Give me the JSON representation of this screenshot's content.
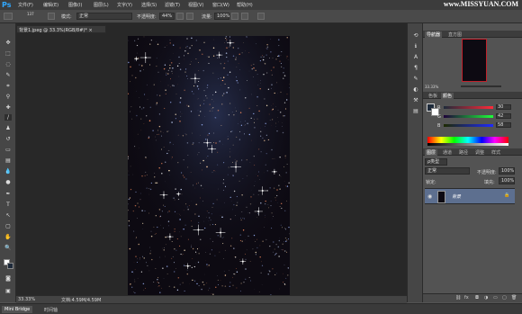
{
  "app": {
    "logo": "Ps"
  },
  "menubar": {
    "items": [
      "文件(F)",
      "编辑(E)",
      "图像(I)",
      "图层(L)",
      "文字(Y)",
      "选择(S)",
      "滤镜(T)",
      "视图(V)",
      "窗口(W)",
      "帮助(H)"
    ]
  },
  "watermark": "www.MISSYUAN.COM",
  "options": {
    "brush_size": "137",
    "mode_label": "模式:",
    "mode_value": "正常",
    "opacity_label": "不透明度:",
    "opacity_value": "44%",
    "flow_label": "流量:",
    "flow_value": "100%"
  },
  "document": {
    "tab_title": "背景1.jpeg @ 33.3%(RGB/8#)*",
    "zoom": "33.33%",
    "doc_size": "文档:4.59M/4.59M"
  },
  "bottom_tabs": [
    "Mini Bridge",
    "时间轴"
  ],
  "navigator": {
    "tabs": [
      "导航器",
      "直方图"
    ],
    "zoom": "33.33%"
  },
  "color_panel": {
    "tabs": [
      "色板",
      "颜色"
    ],
    "r": {
      "label": "R",
      "value": "30"
    },
    "g": {
      "label": "G",
      "value": "42"
    },
    "b": {
      "label": "B",
      "value": "58"
    },
    "fg_color": "#1e2a3a"
  },
  "layers_panel": {
    "tabs": [
      "图层",
      "通道",
      "路径",
      "调整",
      "样式"
    ],
    "kind_label": "ρ类型",
    "blend_mode": "正常",
    "opacity_label": "不透明度:",
    "opacity_value": "100%",
    "lock_label": "锁定:",
    "fill_label": "填充:",
    "fill_value": "100%",
    "layers": [
      {
        "name": "背景",
        "lock": "🔒"
      }
    ]
  },
  "colors": {
    "selected_layer": "#5d6f8f",
    "accent_red": "#c0202a"
  }
}
